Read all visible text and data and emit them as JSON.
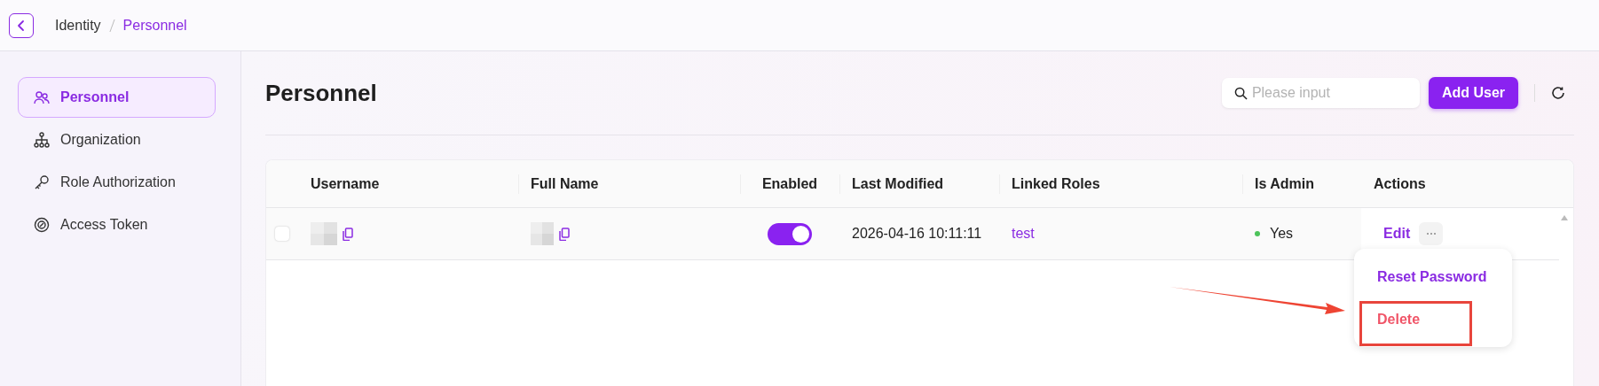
{
  "breadcrumb": [
    {
      "label": "Identity",
      "selected": false
    },
    {
      "label": "Personnel",
      "selected": true
    }
  ],
  "sidebar": {
    "items": [
      {
        "label": "Personnel",
        "kind": "users",
        "selected": true
      },
      {
        "label": "Organization",
        "kind": "hierarchy",
        "selected": false
      },
      {
        "label": "Role Authorization",
        "kind": "key",
        "selected": false
      },
      {
        "label": "Access Token",
        "kind": "token",
        "selected": false
      }
    ]
  },
  "page_title": "Personnel",
  "search": {
    "placeholder": "Please input"
  },
  "add_button": "Add User",
  "table": {
    "columns": [
      "Username",
      "Full Name",
      "Enabled",
      "Last Modified",
      "Linked Roles",
      "Is Admin",
      "Actions"
    ],
    "rows": [
      {
        "checked": false,
        "enabled": true,
        "last_modified": "2026-04-16 10:11:11",
        "linked_roles": "test",
        "is_admin": "Yes",
        "action": "Edit"
      }
    ]
  },
  "menu": {
    "items": [
      {
        "label": "Reset Password",
        "kind": "normal",
        "highlighted": false
      },
      {
        "label": "Delete",
        "kind": "danger",
        "highlighted": true
      }
    ]
  }
}
